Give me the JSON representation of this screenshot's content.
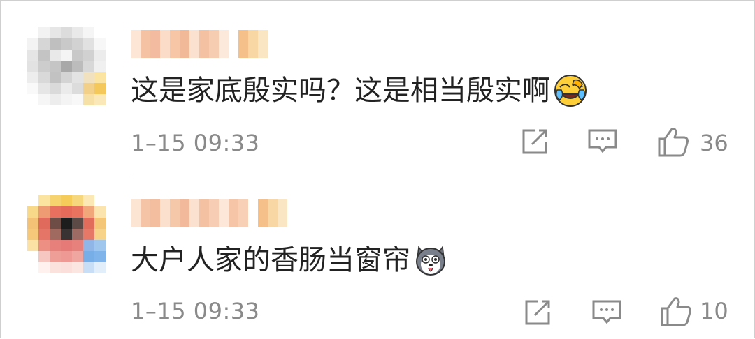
{
  "comments": [
    {
      "text": "这是家底殷实吗？这是相当殷实啊",
      "emoji": "laughing-crying-emoji",
      "time": "1–15 09:33",
      "likes": "36",
      "icons": {
        "share": "share-icon",
        "reply": "comment-icon",
        "like": "thumbs-up-icon"
      }
    },
    {
      "text": "大户人家的香肠当窗帘",
      "emoji": "husky-dog-emoji",
      "time": "1–15 09:33",
      "likes": "10",
      "icons": {
        "share": "share-icon",
        "reply": "comment-icon",
        "like": "thumbs-up-icon"
      }
    }
  ],
  "colors": {
    "text": "#222222",
    "meta": "#8a8a8a",
    "username_blur": "#f6c7a6",
    "divider": "#e6e6e6"
  }
}
